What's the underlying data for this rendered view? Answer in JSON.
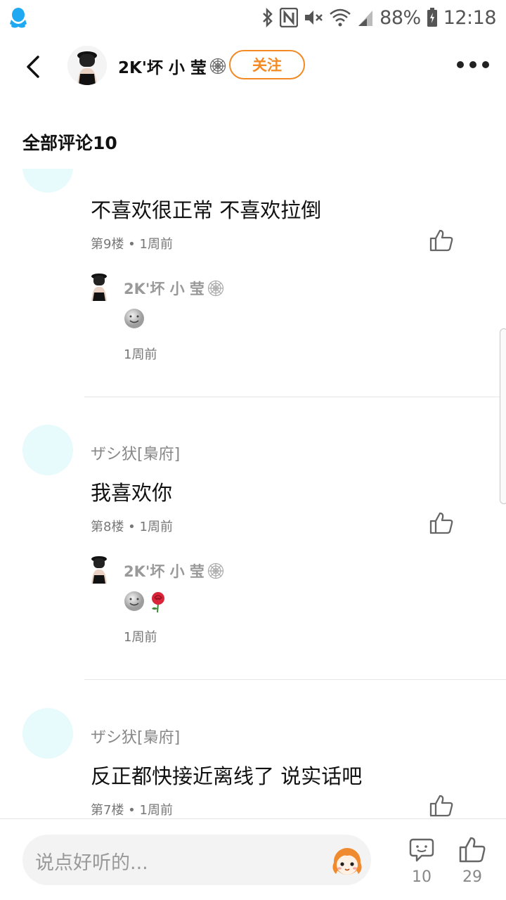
{
  "status_bar": {
    "battery": "88%",
    "time": "12:18",
    "icons": [
      "qq-icon",
      "bluetooth-icon",
      "nfc-icon",
      "mute-icon",
      "wifi-icon",
      "signal-icon",
      "battery-icon"
    ]
  },
  "header": {
    "author_name": "2K'坏 小 莹",
    "follow_label": "关注",
    "icons": [
      "back-icon",
      "spiderweb-icon",
      "more-icon"
    ]
  },
  "section_title": "全部评论10",
  "comments": [
    {
      "text": "不喜欢很正常 不喜欢拉倒",
      "meta": "第9楼 • 1周前",
      "reply": {
        "name": "2K'坏 小 莹",
        "emojis": [
          "smile-emoji"
        ],
        "time": "1周前"
      }
    },
    {
      "user": "ザシ犾[梟府]",
      "text": "我喜欢你",
      "meta": "第8楼 • 1周前",
      "reply": {
        "name": "2K'坏 小 莹",
        "emojis": [
          "smile-emoji",
          "rose-emoji"
        ],
        "time": "1周前"
      }
    },
    {
      "user": "ザシ犾[梟府]",
      "text": "反正都快接近离线了 说实话吧",
      "meta": "第7楼 • 1周前"
    }
  ],
  "bottom_bar": {
    "placeholder": "说点好听的...",
    "comment_count": "10",
    "like_count": "29"
  },
  "colors": {
    "accent": "#f28a26",
    "avatar_bubble": "#e7fafc",
    "qq_blue": "#1ea9f2"
  }
}
